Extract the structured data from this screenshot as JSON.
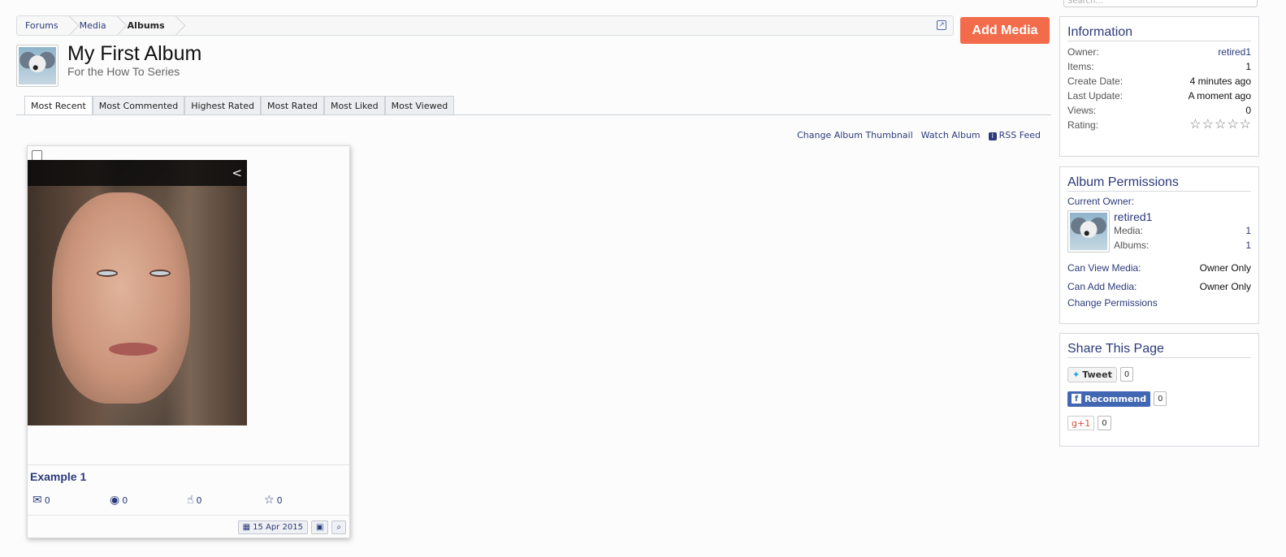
{
  "breadcrumb": [
    "Forums",
    "Media",
    "Albums"
  ],
  "add_media_label": "Add Media",
  "album": {
    "title": "My First Album",
    "subtitle": "For the How To Series"
  },
  "tabs": [
    "Most Recent",
    "Most Commented",
    "Highest Rated",
    "Most Rated",
    "Most Liked",
    "Most Viewed"
  ],
  "active_tab": "Most Recent",
  "actions": {
    "thumbnail": "Change Album Thumbnail",
    "watch": "Watch Album",
    "rss": "RSS Feed"
  },
  "search": {
    "placeholder": "Search..."
  },
  "media_item": {
    "caption": "Example 1",
    "comments": "0",
    "views": "0",
    "likes": "0",
    "rating": "0",
    "date": "15 Apr 2015",
    "icons": [
      "comments-icon",
      "eye-icon",
      "thumbs-up-icon",
      "star-icon",
      "calendar-icon",
      "image-icon",
      "zoom-icon",
      "share-icon"
    ]
  },
  "information": {
    "heading": "Information",
    "owner_label": "Owner:",
    "owner": "retired1",
    "items_label": "Items:",
    "items": "1",
    "create_label": "Create Date:",
    "create": "4 minutes ago",
    "update_label": "Last Update:",
    "update": "A moment ago",
    "views_label": "Views:",
    "views": "0",
    "rating_label": "Rating:",
    "rating_stars": 0
  },
  "permissions": {
    "heading": "Album Permissions",
    "current_owner_label": "Current Owner:",
    "owner_name": "retired1",
    "media_label": "Media:",
    "media": "1",
    "albums_label": "Albums:",
    "albums": "1",
    "view_label": "Can View Media:",
    "view": "Owner Only",
    "add_label": "Can Add Media:",
    "add": "Owner Only",
    "change_link": "Change Permissions"
  },
  "share": {
    "heading": "Share This Page",
    "tweet": "Tweet",
    "tweet_count": "0",
    "recommend": "Recommend",
    "recommend_count": "0",
    "gplus": "+1",
    "gplus_count": "0"
  },
  "colors": {
    "accent": "#f26b4a",
    "link": "#2b3a7a",
    "facebook": "#4267b2"
  }
}
